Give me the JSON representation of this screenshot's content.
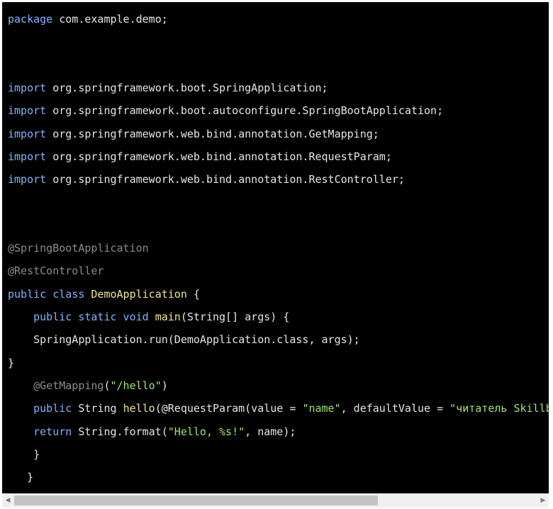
{
  "code": {
    "l1": {
      "kw": "package",
      "rest": " com.example.demo;"
    },
    "l2": {
      "kw": "import",
      "rest": " org.springframework.boot.SpringApplication;"
    },
    "l3": {
      "kw": "import",
      "rest": " org.springframework.boot.autoconfigure.SpringBootApplication;"
    },
    "l4": {
      "kw": "import",
      "rest": " org.springframework.web.bind.annotation.GetMapping;"
    },
    "l5": {
      "kw": "import",
      "rest": " org.springframework.web.bind.annotation.RequestParam;"
    },
    "l6": {
      "kw": "import",
      "rest": " org.springframework.web.bind.annotation.RestController;"
    },
    "l7": {
      "ann": "@SpringBootApplication"
    },
    "l8": {
      "ann": "@RestController"
    },
    "l9": {
      "kw": "public class",
      "sp": " ",
      "fn": "DemoApplication",
      "rest": " {"
    },
    "l10": {
      "indent": "    ",
      "kw": "public static void",
      "sp": " ",
      "fn": "main",
      "rest": "(String[] args) {"
    },
    "l11": {
      "indent": "    ",
      "rest": "SpringApplication.run(DemoApplication.class, args);"
    },
    "l12": {
      "rest": "}"
    },
    "l13": {
      "indent": "    ",
      "ann": "@GetMapping",
      "p1": "(",
      "str": "\"/hello\"",
      "p2": ")"
    },
    "l14": {
      "indent": "    ",
      "kw": "public",
      "t1": " String ",
      "fn": "hello",
      "t2": "(@RequestParam(value = ",
      "str1": "\"name\"",
      "t3": ", defaultValue = ",
      "str2": "\"читатель Skillbox Media\""
    },
    "l15": {
      "indent": "    ",
      "kw": "return",
      "t1": " String.format(",
      "str": "\"Hello, %s!\"",
      "t2": ", name);"
    },
    "l16": {
      "indent": "    ",
      "rest": "}"
    },
    "l17": {
      "indent": "   ",
      "rest": "}"
    }
  },
  "colors": {
    "background": "#000000",
    "keyword": "#80b3ff",
    "annotation": "#8c8c8c",
    "function": "#f0e68c",
    "string": "#9ee86b",
    "text": "#e6e6e6"
  },
  "scrollbar": {
    "left_arrow": "◀",
    "right_arrow": "▶"
  }
}
